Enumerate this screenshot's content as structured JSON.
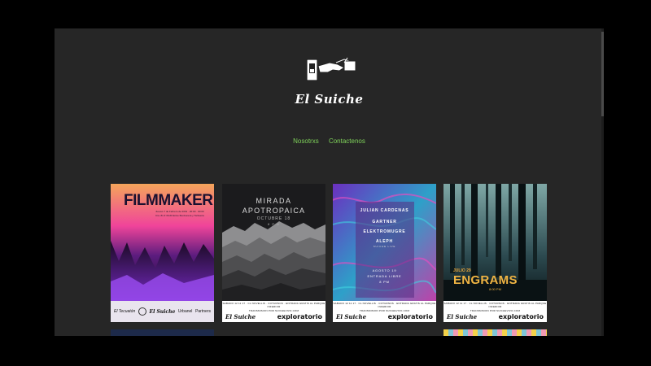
{
  "site": {
    "title": "El Suiche",
    "logo_icon": "switch-hand-icon"
  },
  "nav": {
    "items": [
      "Nosotrxs",
      "Contactenos"
    ]
  },
  "posters": [
    {
      "title": "FILMMAKER",
      "date_line1": "Jueves 7 de Febrero de 2019 · 20:00 · 00:00",
      "date_line2": "Cra. 81 # 36-60 Entre Bonbonera y Tortiseria",
      "sponsors": [
        "El Tecuatón",
        "El Suiche",
        "Urbanel",
        "Partners"
      ]
    },
    {
      "title": "MIRADA",
      "title2": "APOTROPAICA",
      "subtitle": "OCTUBRE 18",
      "time": "8 P.M",
      "footer_line1": "SABADO 12 11 17 · CL NOVELLIS · COTURNOS · ENTRADA GRATIS AL PARQUE INFERIOR",
      "footer_line2": "TRANSMISION POR SUICHEVIVO.COM",
      "brand_left": "El Suiche",
      "brand_right": "exploratorio"
    },
    {
      "artists": [
        "JULIAN CARDENAS",
        "GARTNER",
        "ELEKTROMUGRE",
        "ALEPH"
      ],
      "subtitle": "SUICHE LIVE",
      "date": "AGOSTO 19",
      "entry": "ENTRADA LIBRE",
      "time": "8 PM",
      "footer_line1": "SABADO 12 11 17 · CL NOVELLIS · COTURNOS · ENTRADA GRATIS AL PARQUE INFERIOR",
      "footer_line2": "TRANSMISION POR SUICHEVIVO.COM",
      "brand_left": "El Suiche",
      "brand_right": "exploratorio"
    },
    {
      "date": "JULIO 29",
      "title": "ENGRAMS",
      "time": "8:00 PM",
      "footer_line1": "SABADO 12 11 17 · CL NOVELLIS · COTURNOS · ENTRADA GRATIS AL PARQUE INFERIOR",
      "footer_line2": "TRANSMISION POR SUICHEVIVO.COM",
      "brand_left": "El Suiche",
      "brand_right": "exploratorio"
    }
  ],
  "colors": {
    "background": "#262626",
    "nav_link": "#7fd25a",
    "frame": "#000000"
  }
}
